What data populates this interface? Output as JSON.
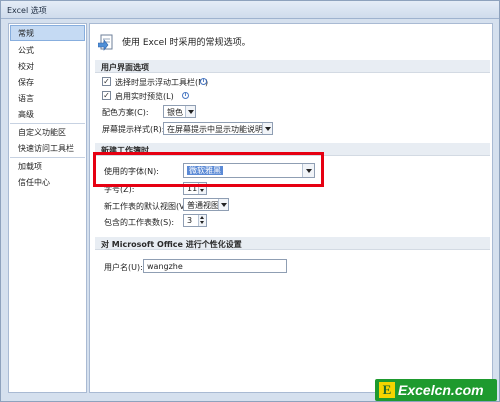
{
  "window": {
    "title": "Excel 选项"
  },
  "sidebar": {
    "items": [
      {
        "label": "常规"
      },
      {
        "label": "公式"
      },
      {
        "label": "校对"
      },
      {
        "label": "保存"
      },
      {
        "label": "语言"
      },
      {
        "label": "高级"
      },
      {
        "label": "自定义功能区"
      },
      {
        "label": "快速访问工具栏"
      },
      {
        "label": "加载项"
      },
      {
        "label": "信任中心"
      }
    ]
  },
  "main": {
    "header": "使用 Excel 时采用的常规选项。",
    "ui_section": {
      "title": "用户界面选项",
      "mini_toolbar_label": "选择时显示浮动工具栏(M)",
      "live_preview_label": "启用实时预览(L)",
      "color_scheme_label": "配色方案(C):",
      "color_scheme_value": "银色",
      "screentip_label": "屏幕提示样式(R):",
      "screentip_value": "在屏幕提示中显示功能说明"
    },
    "new_workbook_section": {
      "title": "新建工作簿时",
      "font_label": "使用的字体(N):",
      "font_value": "微软雅黑",
      "size_label": "字号(Z):",
      "size_value": "11",
      "view_label": "新工作表的默认视图(V):",
      "view_value": "普通视图",
      "sheets_label": "包含的工作表数(S):",
      "sheets_value": "3"
    },
    "personalize_section": {
      "title": "对 Microsoft Office 进行个性化设置",
      "username_label": "用户名(U):",
      "username_value": "wangzhe"
    }
  },
  "watermark": {
    "letter": "E",
    "text": "Excelcn.com"
  },
  "colors": {
    "highlight_border": "#e60012",
    "logo_green": "#1e9a2e",
    "selected_item": "#c5daf3"
  }
}
